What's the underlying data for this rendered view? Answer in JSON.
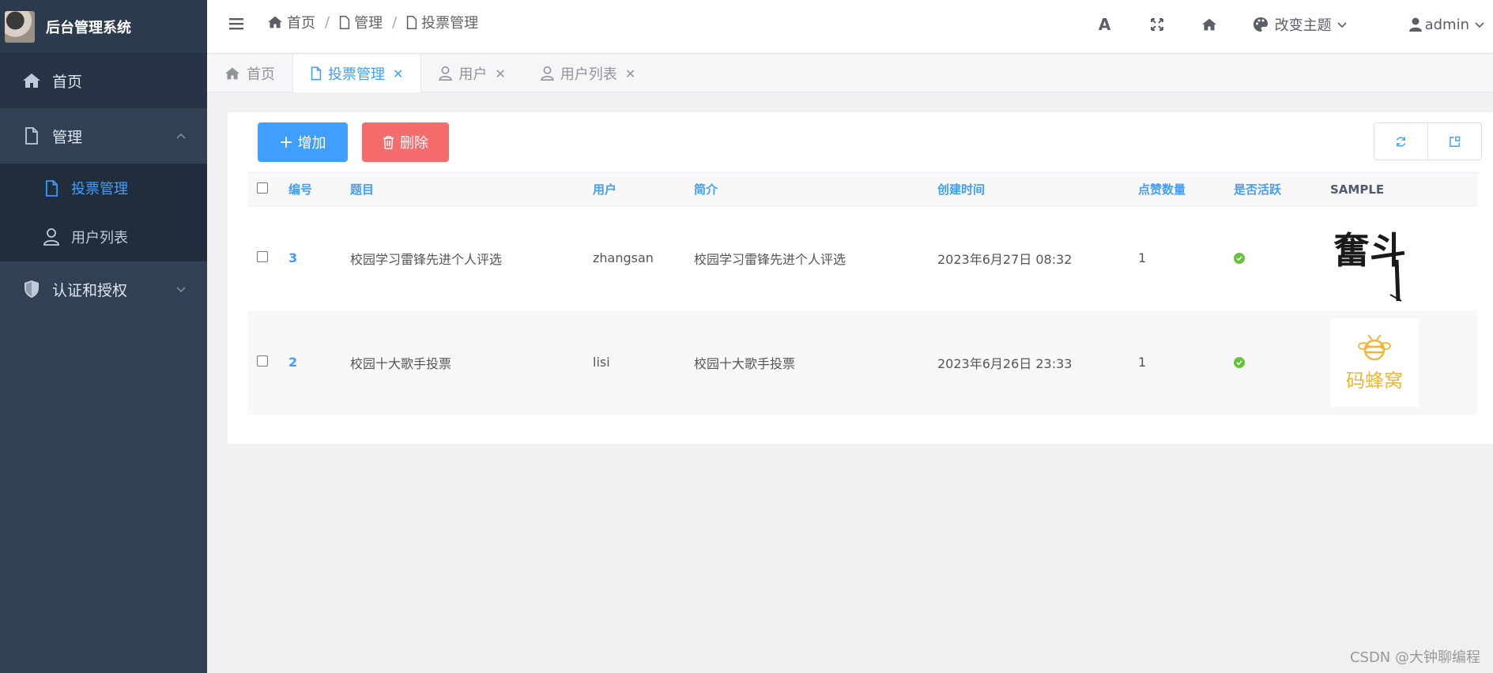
{
  "app": {
    "title": "后台管理系统"
  },
  "sidebar": {
    "items": [
      {
        "label": "首页",
        "icon": "home-icon"
      },
      {
        "label": "管理",
        "icon": "file-icon",
        "expanded": true,
        "children": [
          {
            "label": "投票管理",
            "icon": "file-icon",
            "active": true
          },
          {
            "label": "用户列表",
            "icon": "user-icon"
          }
        ]
      },
      {
        "label": "认证和授权",
        "icon": "shield-icon",
        "expanded": false
      }
    ]
  },
  "header": {
    "breadcrumb": [
      "首页",
      "管理",
      "投票管理"
    ],
    "font_icon": "A",
    "theme_label": "改变主题",
    "user_label": "admin"
  },
  "tags": [
    {
      "label": "首页",
      "icon": "home-icon",
      "closable": false
    },
    {
      "label": "投票管理",
      "icon": "file-icon",
      "active": true,
      "closable": true
    },
    {
      "label": "用户",
      "icon": "user-icon",
      "closable": true
    },
    {
      "label": "用户列表",
      "icon": "user-icon",
      "closable": true
    }
  ],
  "toolbar": {
    "add_label": "增加",
    "delete_label": "删除"
  },
  "table": {
    "columns": [
      "编号",
      "题目",
      "用户",
      "简介",
      "创建时间",
      "点赞数量",
      "是否活跃",
      "SAMPLE"
    ],
    "rows": [
      {
        "id": "3",
        "title": "校园学习雷锋先进个人评选",
        "user": "zhangsan",
        "intro": "校园学习雷锋先进个人评选",
        "created": "2023年6月27日 08:32",
        "likes": "1",
        "active": true,
        "sample_text": "奮斗"
      },
      {
        "id": "2",
        "title": "校园十大歌手投票",
        "user": "lisi",
        "intro": "校园十大歌手投票",
        "created": "2023年6月26日 23:33",
        "likes": "1",
        "active": true,
        "sample_text": "码蜂窝"
      }
    ]
  },
  "watermark": "CSDN @大钟聊编程",
  "colors": {
    "primary": "#409eff",
    "danger": "#f56c6c",
    "success": "#67c23a",
    "sidebar": "#304156"
  }
}
